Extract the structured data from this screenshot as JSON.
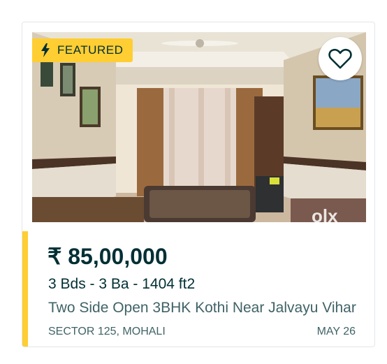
{
  "listing": {
    "badge_label": "FEATURED",
    "badge_icon": "lightning-icon",
    "favorite_icon": "heart-outline-icon",
    "price": "₹ 85,00,000",
    "specs": "3 Bds - 3 Ba - 1404 ft2",
    "title": "Two Side Open 3BHK Kothi Near Jalvayu Vihar",
    "location": "SECTOR 125, MOHALI",
    "date": "MAY 26"
  },
  "colors": {
    "accent": "#ffce32",
    "primary_text": "#002f34",
    "secondary_text": "#406367"
  }
}
